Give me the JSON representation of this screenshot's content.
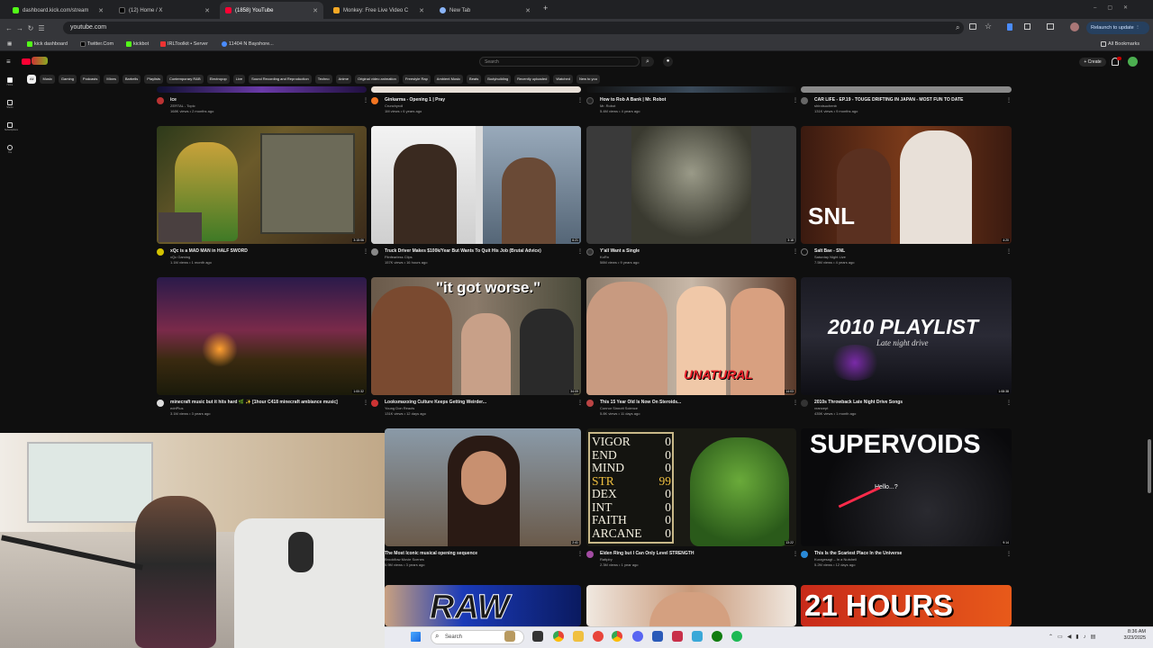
{
  "browser": {
    "tabs": [
      {
        "label": "dashboard.kick.com/stream",
        "color": "#53fc18"
      },
      {
        "label": "(12) Home / X",
        "color": "#000000"
      },
      {
        "label": "(1858) YouTube",
        "color": "#ff0033"
      },
      {
        "label": "Monkey: Free Live Video C",
        "color": "#f4a825"
      },
      {
        "label": "New Tab",
        "color": "#8ab4f8"
      }
    ],
    "url": "youtube.com",
    "relaunch": "Relaunch to update",
    "bookmarks": [
      "kick dashboard",
      "Twitter.Com",
      "kickbot",
      "IRLToolkit • Server",
      "11404 N Bayshore..."
    ],
    "all_bookmarks": "All Bookmarks"
  },
  "youtube": {
    "search_placeholder": "Search",
    "create": "Create",
    "chips": [
      "All",
      "Music",
      "Gaming",
      "Podcasts",
      "Mixes",
      "Barbells",
      "Playlists",
      "Contemporary R&B",
      "Electropop",
      "Live",
      "Sound Recording and Reproduction",
      "Techno",
      "Anime",
      "Original video animation",
      "Freestyle Rap",
      "Ambient Music",
      "Beats",
      "Bodybuilding",
      "Recently uploaded",
      "Watched",
      "New to you"
    ],
    "sidebar": [
      "Home",
      "Shorts",
      "Subscriptions",
      "You"
    ],
    "row0": [
      {
        "title": "ice",
        "channel": "ZERTAL - Topic",
        "meta": "168K views • 2 months ago"
      },
      {
        "title": "Ginkarma - Opening 1 | Pray",
        "channel": "Crunchyroll",
        "meta": "1M views • 6 years ago"
      },
      {
        "title": "How to Rob A Bank | Mr. Robot",
        "channel": "Mr. Robot",
        "meta": "5.4M views • 4 years ago"
      },
      {
        "title": "CAR LIFE - EP.19 - TOUGE DRIFTING IN JAPAN - MOST FUN TO DATE",
        "channel": "shirotsuchenb",
        "meta": "131K views • 9 months ago"
      }
    ],
    "row1": [
      {
        "title": "xQc is a MAD MAN in HALF SWORD",
        "channel": "xQc Gaming",
        "meta": "1.1M views • 1 month ago",
        "dur": "3:15:06"
      },
      {
        "title": "Truck Driver Makes $100k/Year But Wants To Quit His Job (Brutal Advice)",
        "channel": "Fitnfearless Clips",
        "meta": "157K views • 16 hours ago",
        "dur": "6:21"
      },
      {
        "title": "Y'all Want a Single",
        "channel": "KoRn",
        "meta": "58M views • 9 years ago",
        "dur": "3:18"
      },
      {
        "title": "Salt Bae - SNL",
        "channel": "Saturday Night Live",
        "meta": "7.5M views • 4 years ago",
        "dur": "4:20"
      }
    ],
    "row2": [
      {
        "title": "minecraft music but it hits hard 🌿 ✨ [1hour C418 minecraft ambiance music]",
        "channel": "edriPlus",
        "meta": "3.1M views • 3 years ago",
        "dur": "1:00:32"
      },
      {
        "title": "Looksmaxxing Culture Keeps Getting Weirder...",
        "channel": "Young Don Reacts",
        "meta": "131K views • 12 days ago",
        "dur": "34:09"
      },
      {
        "title": "This 15 Year Old Is Now On Steroids...",
        "channel": "Connor Sinnott Science",
        "meta": "5.8K views • 11 days ago",
        "dur": "14:03"
      },
      {
        "title": "2010s Throwback Late Night Drive Songs",
        "channel": "vrancept",
        "meta": "435K views • 1 month ago",
        "dur": "1:08:38"
      }
    ],
    "row3": [
      {
        "title": "The Most Iconic musical opening sequence",
        "channel": "Brookflow Movie Scenes",
        "meta": "5.9M views • 3 years ago",
        "dur": "2:41"
      },
      {
        "title": "Elden Ring but I Can Only Level STRENGTH",
        "channel": "Rattplry",
        "meta": "2.3M views • 1 year ago",
        "dur": "13:22"
      },
      {
        "title": "This Is the Scariest Place In the Universe",
        "channel": "Kurzgesagt – In a Nutshell",
        "meta": "5.2M views • 12 days ago",
        "dur": "9:14"
      }
    ],
    "thumb_text": {
      "worse": "\"it got worse.\"",
      "unatural": "UNATURAL",
      "playlist": "2010 PLAYLIST",
      "playlist_sub": "Late night drive",
      "snl": "SNL",
      "supervoids": "SUPERVOIDS",
      "hello": "Hello...?",
      "hours": "21 HOURS",
      "raw": "RAW",
      "stats": [
        [
          "VIGOR",
          "0"
        ],
        [
          "END",
          "0"
        ],
        [
          "MIND",
          "0"
        ],
        [
          "STR",
          "99"
        ],
        [
          "DEX",
          "0"
        ],
        [
          "INT",
          "0"
        ],
        [
          "FAITH",
          "0"
        ],
        [
          "ARCANE",
          "0"
        ]
      ]
    }
  },
  "taskbar": {
    "search": "Search",
    "time": "8:36 AM",
    "date": "3/23/2025"
  }
}
